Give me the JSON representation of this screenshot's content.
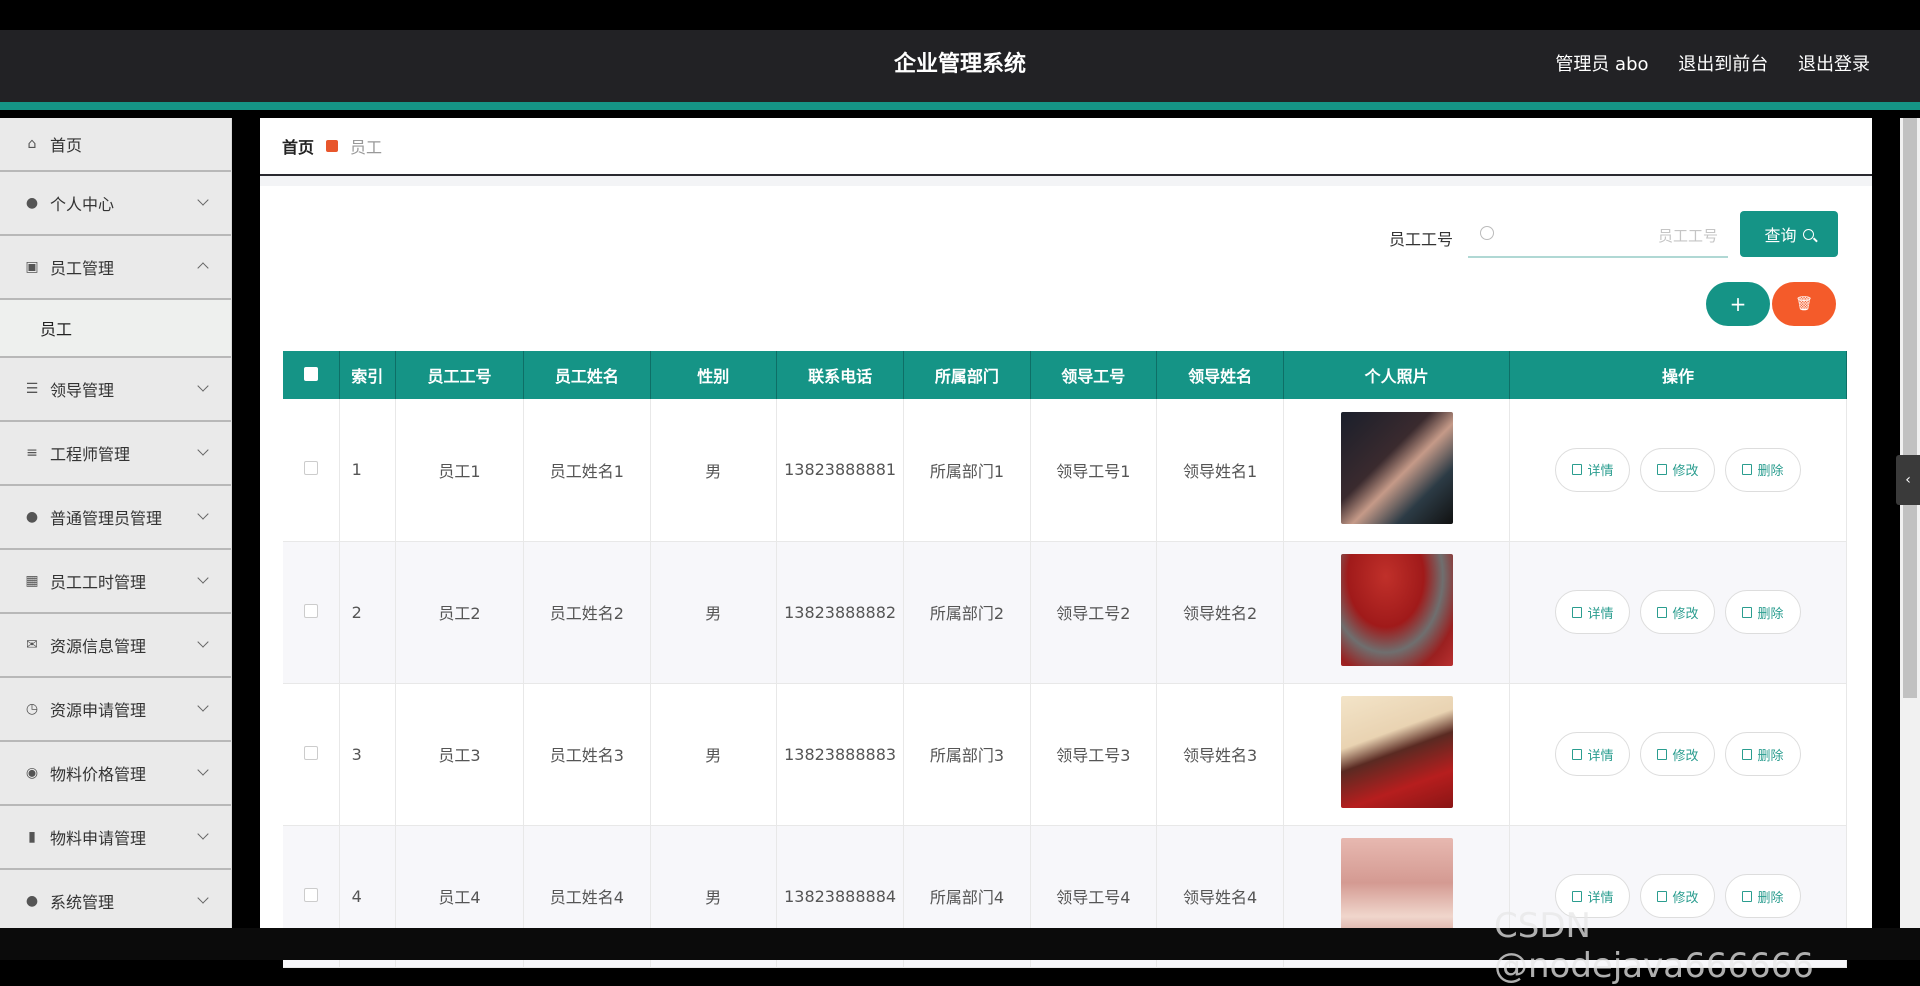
{
  "header": {
    "title": "企业管理系统",
    "user": "管理员 abo",
    "back_front": "退出到前台",
    "logout": "退出登录"
  },
  "sidebar": {
    "items": [
      {
        "label": "首页",
        "icon": "home-icon"
      },
      {
        "label": "个人中心",
        "icon": "user-icon"
      },
      {
        "label": "员工管理",
        "icon": "clipboard-icon",
        "expanded": true,
        "children": [
          "员工"
        ]
      },
      {
        "label": "领导管理",
        "icon": "sliders-icon"
      },
      {
        "label": "工程师管理",
        "icon": "list-icon"
      },
      {
        "label": "普通管理员管理",
        "icon": "user-icon"
      },
      {
        "label": "员工工时管理",
        "icon": "grid-icon"
      },
      {
        "label": "资源信息管理",
        "icon": "mail-icon"
      },
      {
        "label": "资源申请管理",
        "icon": "clock-icon"
      },
      {
        "label": "物料价格管理",
        "icon": "mic-icon"
      },
      {
        "label": "物料申请管理",
        "icon": "bar-chart-icon"
      },
      {
        "label": "系统管理",
        "icon": "bulb-icon"
      }
    ]
  },
  "breadcrumb": {
    "home": "首页",
    "current": "员工"
  },
  "search": {
    "label": "员工工号",
    "placeholder": "员工工号",
    "button": "查询"
  },
  "actions": {
    "add": "+",
    "delete": "🗑"
  },
  "table": {
    "columns": [
      "索引",
      "员工工号",
      "员工姓名",
      "性别",
      "联系电话",
      "所属部门",
      "领导工号",
      "领导姓名",
      "个人照片",
      "操作"
    ],
    "rows": [
      {
        "index": "1",
        "emp_no": "员工1",
        "name": "员工姓名1",
        "gender": "男",
        "phone": "13823888881",
        "dept": "所属部门1",
        "leader_no": "领导工号1",
        "leader_name": "领导姓名1"
      },
      {
        "index": "2",
        "emp_no": "员工2",
        "name": "员工姓名2",
        "gender": "男",
        "phone": "13823888882",
        "dept": "所属部门2",
        "leader_no": "领导工号2",
        "leader_name": "领导姓名2"
      },
      {
        "index": "3",
        "emp_no": "员工3",
        "name": "员工姓名3",
        "gender": "男",
        "phone": "13823888883",
        "dept": "所属部门3",
        "leader_no": "领导工号3",
        "leader_name": "领导姓名3"
      },
      {
        "index": "4",
        "emp_no": "员工4",
        "name": "员工姓名4",
        "gender": "男",
        "phone": "13823888884",
        "dept": "所属部门4",
        "leader_no": "领导工号4",
        "leader_name": "领导姓名4"
      }
    ],
    "ops": {
      "detail": "详情",
      "edit": "修改",
      "delete": "删除"
    }
  },
  "watermark": "CSDN @nodejava666666",
  "colors": {
    "accent": "#159486",
    "danger": "#f45b2a",
    "header_bg": "#222225"
  }
}
